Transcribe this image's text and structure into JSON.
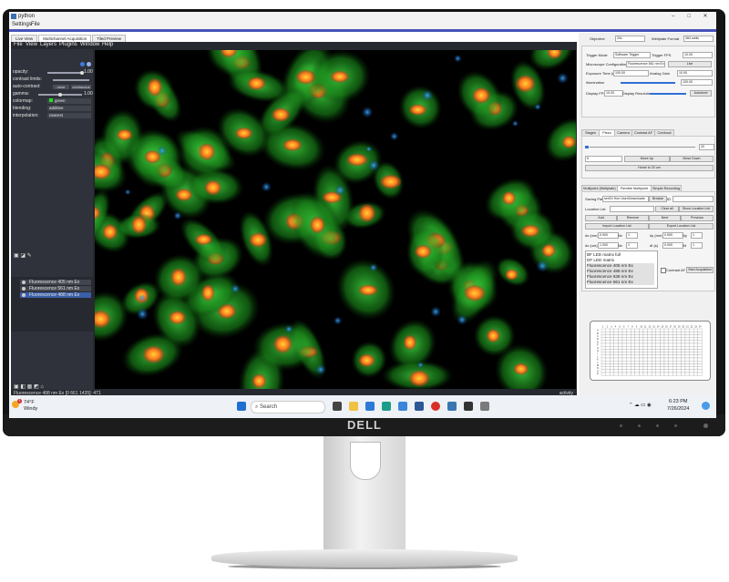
{
  "window": {
    "title": "python",
    "controls": [
      "–",
      "□",
      "✕"
    ]
  },
  "menu": {
    "settings": "Settings",
    "file": "File"
  },
  "top_tabs": [
    "Live View",
    "Multichannel Acquisition",
    "Tiled Preview"
  ],
  "napari_menu": [
    "File",
    "View",
    "Layers",
    "Plugins",
    "Window",
    "Help"
  ],
  "layer_controls": {
    "opacity_label": "opacity:",
    "opacity_value": "1.00",
    "contrast_label": "contrast limits:",
    "auto_contrast_label": "auto-contrast:",
    "auto_once": "once",
    "auto_continuous": "continuous",
    "gamma_label": "gamma:",
    "gamma_value": "1.00",
    "colormap_label": "colormap:",
    "colormap_value": "green",
    "blending_label": "blending:",
    "blending_value": "additive",
    "interpolation_label": "interpolation:",
    "interpolation_value": "nearest"
  },
  "layers": [
    {
      "name": "Fluorescence 405 nm Ex",
      "selected": false
    },
    {
      "name": "Fluorescence 561 nm Ex",
      "selected": false
    },
    {
      "name": "Fluorescence 488 nm Ex",
      "selected": true
    }
  ],
  "status_bar": {
    "text": "Fluorescence 488 nm Ex [0 661 1435]: 471",
    "activity": "activity"
  },
  "right_panel": {
    "objective_label": "Objective",
    "objective_value": "20x",
    "wellplate_label": "Wellplate Format",
    "wellplate_value": "384 wells",
    "trigger_mode_label": "Trigger Mode",
    "trigger_mode_value": "Software Trigger",
    "trigger_fps_label": "Trigger FPS",
    "trigger_fps_value": "10.00",
    "mic_config_label": "Microscope Configuration",
    "mic_config_value": "Fluorescence 561 nm Ex",
    "live_btn": "Live",
    "exposure_label": "Exposure Time (ms)",
    "exposure_value": "100.00",
    "analog_gain_label": "Analog Gain",
    "analog_gain_value": "10.00",
    "illumination_label": "Illumination",
    "illumination_value": "100.00",
    "display_fps_label": "Display FPS",
    "display_fps_value": "10.00",
    "display_res_label": "Display Resolution",
    "autolevel_btn": "Autolevel",
    "nav_tabs": [
      "Stages",
      "Piezo",
      "Camera",
      "Contrast AF",
      "Confocal"
    ],
    "piezo_value": "20",
    "step_value": "5",
    "move_up": "Move Up",
    "move_down": "Move Down",
    "home": "Home to 20 um",
    "acq_tabs": [
      "Multipoint (Wellplate)",
      "Flexible Multipoint",
      "Simple Recording"
    ],
    "saving_path_label": "Saving Path",
    "saving_path_value": "ser\\Dr Hon User\\Downloads",
    "browse_btn": "Browse",
    "id_label": "ID",
    "location_list_label": "Location List",
    "clear_all": "Clear all",
    "show_location_list": "Show Location List",
    "add_btn": "Add",
    "remove_btn": "Remove",
    "next_btn": "Next",
    "previous_btn": "Previous",
    "import_btn": "Import Location List",
    "export_btn": "Export Location List",
    "dx_label": "dx (mm)",
    "dx_value": "0.900",
    "nx_label": "Nx",
    "nx_value": "1",
    "dy_label": "dy (mm)",
    "dy_value": "0.900",
    "ny_label": "Ny",
    "ny_value": "1",
    "dz_label": "dz (um)",
    "dz_value": "1.000",
    "nz_label": "Nz",
    "nz_value": "1",
    "dt_label": "dt (s)",
    "dt_value": "0.000",
    "nt_label": "Nt",
    "nt_value": "1",
    "channels": [
      "BF LED matrix full",
      "DF LED matrix",
      "Fluorescence 405 nm Ex",
      "Fluorescence 488 nm Ex",
      "Fluorescence 638 nm Ex",
      "Fluorescence 561 nm Ex"
    ],
    "contrast_af": "Contrast AF",
    "start_acq": "Start Acquisition",
    "plate_rows": [
      "A",
      "B",
      "C",
      "D",
      "E",
      "F",
      "G",
      "H",
      "I",
      "J",
      "K",
      "L",
      "M",
      "N",
      "O",
      "P"
    ],
    "plate_cols": [
      "1",
      "2",
      "3",
      "4",
      "5",
      "6",
      "7",
      "8",
      "9",
      "10",
      "11",
      "12",
      "13",
      "14",
      "15",
      "16",
      "17",
      "18",
      "19",
      "20",
      "21",
      "22",
      "23",
      "24"
    ]
  },
  "taskbar": {
    "weather_temp": "74°F",
    "weather_desc": "Windy",
    "weather_badge": "1",
    "search_placeholder": "Search",
    "time": "6:23 PM",
    "date": "7/26/2024"
  },
  "monitor_brand": "DELL"
}
